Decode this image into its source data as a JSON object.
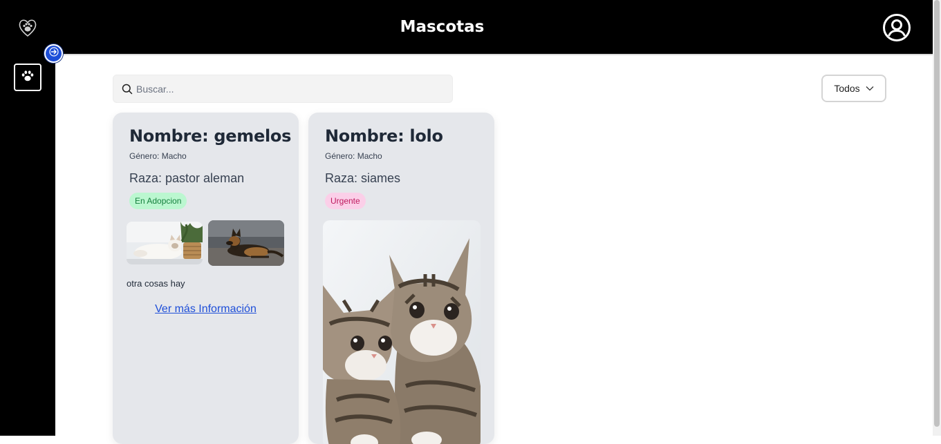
{
  "header": {
    "title": "Mascotas",
    "logo_icon": "paw-heart-logo-icon",
    "user_icon": "user-circle-icon"
  },
  "sidebar": {
    "items": [
      {
        "icon": "paw-icon"
      }
    ],
    "expand_icon": "arrow-right-icon"
  },
  "toolbar": {
    "search_placeholder": "Buscar...",
    "filter_label": "Todos"
  },
  "pets": [
    {
      "name": "Nombre: gemelos",
      "gender": "Género: Macho",
      "breed": "Raza: pastor aleman",
      "status": "En Adopcion",
      "description": "otra cosas hay",
      "more_link": "Ver más Información"
    },
    {
      "name": "Nombre: lolo",
      "gender": "Género: Macho",
      "breed": "Raza: siames",
      "status": "Urgente"
    }
  ],
  "colors": {
    "header_bg": "#000000",
    "card_bg": "#e5e7eb",
    "link": "#1d4ed8",
    "badge_green": "#bbf7d0",
    "badge_pink": "#fbcfe8"
  }
}
